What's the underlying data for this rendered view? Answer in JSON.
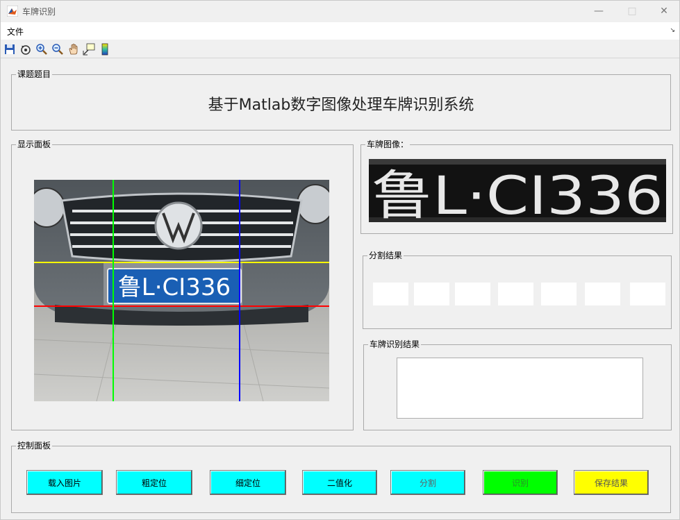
{
  "window": {
    "title": "车牌识别"
  },
  "menu": {
    "file": "文件"
  },
  "toolbar": {
    "icons": [
      "save-icon",
      "rotate-icon",
      "zoom-in-icon",
      "zoom-out-icon",
      "pan-icon",
      "data-cursor-icon",
      "colorbar-icon"
    ]
  },
  "panels": {
    "topic": {
      "label": "课题题目",
      "title": "基于Matlab数字图像处理车牌识别系统"
    },
    "display": {
      "label": "显示面板"
    },
    "plate_image": {
      "label": "车牌图像："
    },
    "segment": {
      "label": "分割结果"
    },
    "recog": {
      "label": "车牌识别结果"
    },
    "control": {
      "label": "控制面板"
    }
  },
  "plate": {
    "text_photo": "鲁L·CI336",
    "text_crop": "鲁L·CI336"
  },
  "buttons": {
    "load": "载入图片",
    "coarse": "粗定位",
    "fine": "细定位",
    "binarize": "二值化",
    "segment": "分割",
    "recognize": "识别",
    "save": "保存结果"
  },
  "colors": {
    "cyan": "#00ffff",
    "green": "#00ff00",
    "yellow": "#ffff00",
    "plate_blue": "#1a5fb4",
    "guide_green": "#00ff00",
    "guide_blue": "#0000ff",
    "guide_yellow": "#ffff00",
    "guide_red": "#ff0000"
  }
}
